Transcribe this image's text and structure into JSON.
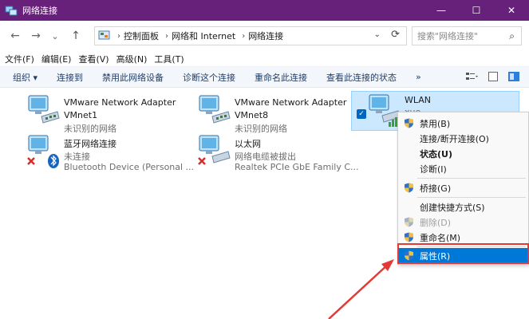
{
  "window": {
    "title": "网络连接",
    "controls": [
      "—",
      "☐",
      "✕"
    ]
  },
  "nav": {
    "back": "←",
    "forward": "→",
    "recent": "⌄",
    "up": "↑"
  },
  "address": {
    "crumbs": [
      "控制面板",
      "网络和 Internet",
      "网络连接"
    ],
    "sep": "›"
  },
  "search": {
    "placeholder": "搜索\"网络连接\""
  },
  "menubar": {
    "items": [
      "文件(F)",
      "编辑(E)",
      "查看(V)",
      "高级(N)",
      "工具(T)"
    ]
  },
  "toolbar": {
    "items": [
      "组织 ▾",
      "连接到",
      "禁用此网络设备",
      "诊断这个连接",
      "重命名此连接",
      "查看此连接的状态"
    ],
    "more": "»"
  },
  "adapters": [
    {
      "name": "VMware Network Adapter",
      "name2": "VMnet1",
      "status": "未识别的网络"
    },
    {
      "name": "VMware Network Adapter",
      "name2": "VMnet8",
      "status": "未识别的网络"
    },
    {
      "name": "WLAN",
      "status": "xue"
    },
    {
      "name": "蓝牙网络连接",
      "status": "未连接",
      "device": "Bluetooth Device (Personal ..."
    },
    {
      "name": "以太网",
      "status": "网络电缆被拔出",
      "device": "Realtek PCIe GbE Family C..."
    }
  ],
  "context_menu": {
    "items": [
      {
        "label": "禁用(B)",
        "shield": true
      },
      {
        "label": "连接/断开连接(O)"
      },
      {
        "label": "状态(U)",
        "bold": true
      },
      {
        "label": "诊断(I)"
      },
      {
        "label": "桥接(G)",
        "shield": true
      },
      {
        "label": "创建快捷方式(S)"
      },
      {
        "label": "删除(D)",
        "shield": true,
        "disabled": true
      },
      {
        "label": "重命名(M)",
        "shield": true
      },
      {
        "label": "属性(R)",
        "shield": true,
        "highlight": true
      }
    ]
  },
  "colors": {
    "titlebar": "#68217a",
    "highlight": "#0078d7",
    "annotation": "#e53935"
  }
}
